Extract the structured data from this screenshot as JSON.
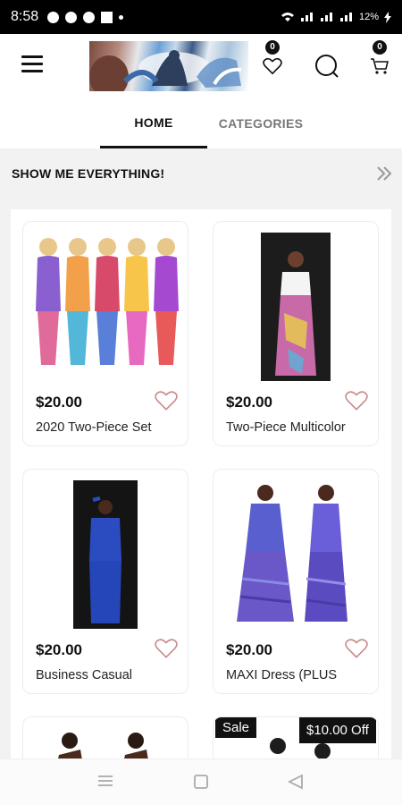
{
  "status_bar": {
    "time": "8:58",
    "battery": "12%"
  },
  "header": {
    "logo_label": "store logo",
    "wishlist_count": "0",
    "cart_count": "0"
  },
  "tabs": [
    {
      "label": "HOME",
      "active": true
    },
    {
      "label": "CATEGORIES",
      "active": false
    }
  ],
  "section": {
    "title": "SHOW ME EVERYTHING!"
  },
  "products": [
    {
      "price": "$20.00",
      "name": "2020 Two-Piece Set"
    },
    {
      "price": "$20.00",
      "name": "Two-Piece Multicolor"
    },
    {
      "price": "$20.00",
      "name": "Business Casual"
    },
    {
      "price": "$20.00",
      "name": "MAXI Dress (PLUS"
    }
  ],
  "promo": {
    "sale_label": "Sale",
    "discount_label": "$10.00 Off"
  },
  "colors": {
    "accent": "#111111",
    "heart": "#c98b8b",
    "background": "#f2f2f2"
  },
  "icons": [
    "menu-icon",
    "heart-icon",
    "search-icon",
    "cart-icon",
    "double-chevron-right-icon",
    "recents-icon",
    "home-icon",
    "back-icon"
  ]
}
